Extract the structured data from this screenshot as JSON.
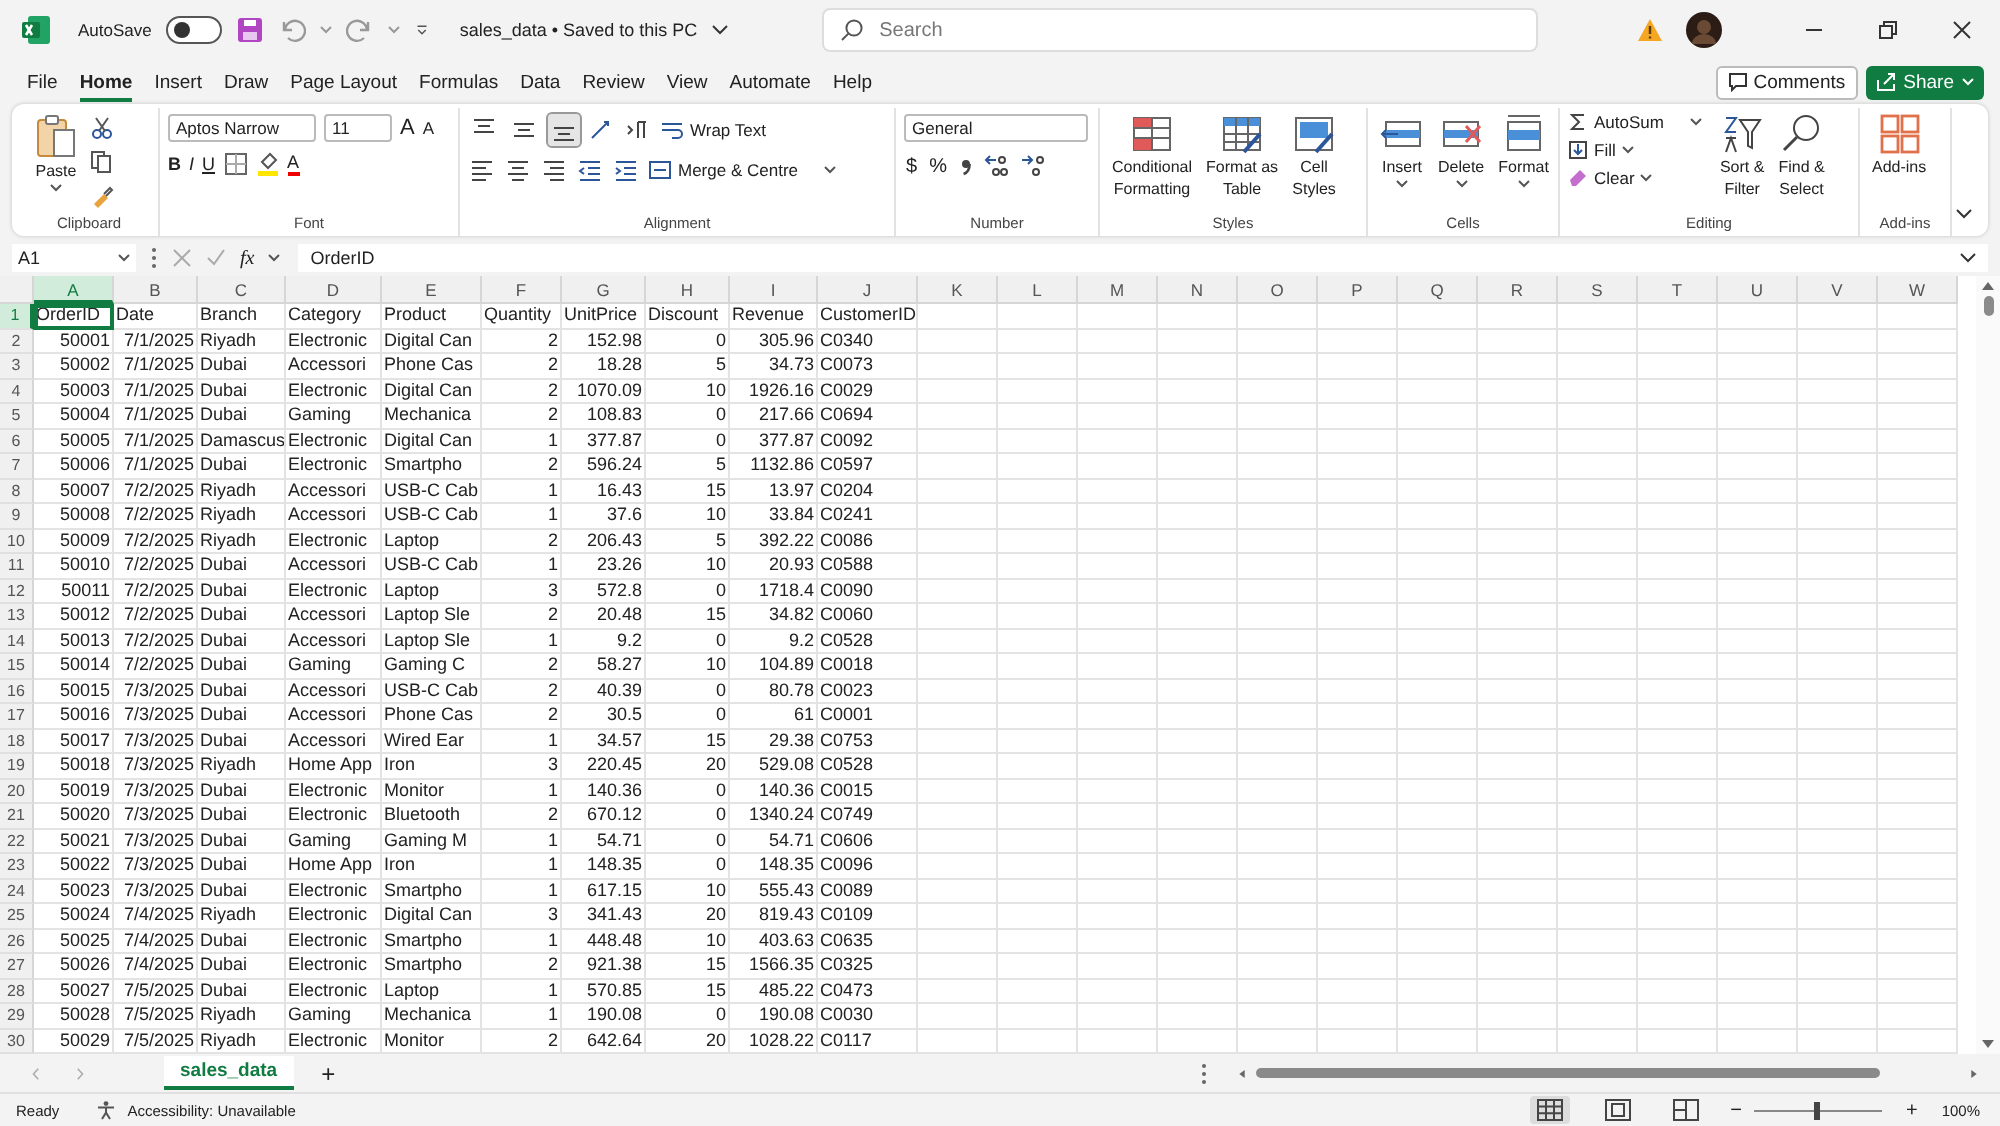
{
  "title_bar": {
    "autosave_label": "AutoSave",
    "autosave_on": false,
    "document_title": "sales_data • Saved to this PC",
    "search_placeholder": "Search"
  },
  "menu_tabs": [
    {
      "label": "File",
      "selected": false
    },
    {
      "label": "Home",
      "selected": true
    },
    {
      "label": "Insert",
      "selected": false
    },
    {
      "label": "Draw",
      "selected": false
    },
    {
      "label": "Page Layout",
      "selected": false
    },
    {
      "label": "Formulas",
      "selected": false
    },
    {
      "label": "Data",
      "selected": false
    },
    {
      "label": "Review",
      "selected": false
    },
    {
      "label": "View",
      "selected": false
    },
    {
      "label": "Automate",
      "selected": false
    },
    {
      "label": "Help",
      "selected": false
    }
  ],
  "top_buttons": {
    "comments": "Comments",
    "share": "Share"
  },
  "ribbon": {
    "clipboard": {
      "label": "Clipboard",
      "paste": "Paste"
    },
    "font": {
      "label": "Font",
      "family": "Aptos Narrow",
      "size": "11",
      "grow": "A",
      "shrink": "A",
      "styles": [
        "B",
        "I",
        "U"
      ],
      "font_color": "A"
    },
    "alignment": {
      "label": "Alignment",
      "vertical": [
        {
          "kind": "top",
          "selected": false
        },
        {
          "kind": "middle",
          "selected": false
        },
        {
          "kind": "bottom",
          "selected": true
        }
      ],
      "wrap": "Wrap Text",
      "merge": "Merge & Centre"
    },
    "number": {
      "label": "Number",
      "format": "General",
      "currency": "$",
      "percent": "%"
    },
    "styles": {
      "label": "Styles",
      "buttons": [
        {
          "kind": "conditional",
          "lines": [
            "Conditional",
            "Formatting"
          ]
        },
        {
          "kind": "table",
          "lines": [
            "Format as",
            "Table"
          ]
        },
        {
          "kind": "cellstyles",
          "lines": [
            "Cell",
            "Styles"
          ]
        }
      ]
    },
    "cells": {
      "label": "Cells",
      "buttons": [
        {
          "kind": "insert",
          "label": "Insert"
        },
        {
          "kind": "delete",
          "label": "Delete"
        },
        {
          "kind": "format",
          "label": "Format"
        }
      ]
    },
    "editing": {
      "label": "Editing",
      "autosum": "AutoSum",
      "fill": "Fill",
      "clear": "Clear",
      "buttons": [
        {
          "kind": "sort",
          "lines": [
            "Sort &",
            "Filter"
          ]
        },
        {
          "kind": "find",
          "lines": [
            "Find &",
            "Select"
          ]
        }
      ]
    },
    "addins": {
      "label": "Add-ins",
      "button": "Add-ins"
    }
  },
  "formula_bar": {
    "name_box": "A1",
    "fx": "fx",
    "content": "OrderID"
  },
  "sheet": {
    "columns": [
      {
        "letter": "A",
        "selected": true,
        "numeric": true
      },
      {
        "letter": "B",
        "selected": false,
        "numeric": true
      },
      {
        "letter": "C",
        "selected": false
      },
      {
        "letter": "D",
        "selected": false
      },
      {
        "letter": "E",
        "selected": false
      },
      {
        "letter": "F",
        "selected": false,
        "numeric": true
      },
      {
        "letter": "G",
        "selected": false,
        "numeric": true
      },
      {
        "letter": "H",
        "selected": false,
        "numeric": true
      },
      {
        "letter": "I",
        "selected": false,
        "numeric": true
      },
      {
        "letter": "J",
        "selected": false
      },
      {
        "letter": "K",
        "selected": false
      },
      {
        "letter": "L",
        "selected": false
      },
      {
        "letter": "M",
        "selected": false
      },
      {
        "letter": "N",
        "selected": false
      },
      {
        "letter": "O",
        "selected": false
      },
      {
        "letter": "P",
        "selected": false
      },
      {
        "letter": "Q",
        "selected": false
      },
      {
        "letter": "R",
        "selected": false
      },
      {
        "letter": "S",
        "selected": false
      },
      {
        "letter": "T",
        "selected": false
      },
      {
        "letter": "U",
        "selected": false
      },
      {
        "letter": "V",
        "selected": false
      },
      {
        "letter": "W",
        "selected": false
      }
    ],
    "rows": [
      {
        "number": "1",
        "selected": true,
        "kind": "header",
        "cells": [
          "OrderID",
          "Date",
          "Branch",
          "Category",
          "Product",
          "Quantity",
          "UnitPrice",
          "Discount",
          "Revenue",
          "CustomerID"
        ]
      },
      {
        "number": "2",
        "selected": false,
        "kind": "data",
        "cells": [
          "50001",
          "7/1/2025",
          "Riyadh",
          "Electronic",
          "Digital Can",
          "2",
          "152.98",
          "0",
          "305.96",
          "C0340"
        ]
      },
      {
        "number": "3",
        "selected": false,
        "kind": "data",
        "cells": [
          "50002",
          "7/1/2025",
          "Dubai",
          "Accessori",
          "Phone Cas",
          "2",
          "18.28",
          "5",
          "34.73",
          "C0073"
        ]
      },
      {
        "number": "4",
        "selected": false,
        "kind": "data",
        "cells": [
          "50003",
          "7/1/2025",
          "Dubai",
          "Electronic",
          "Digital Can",
          "2",
          "1070.09",
          "10",
          "1926.16",
          "C0029"
        ]
      },
      {
        "number": "5",
        "selected": false,
        "kind": "data",
        "cells": [
          "50004",
          "7/1/2025",
          "Dubai",
          "Gaming",
          "Mechanica",
          "2",
          "108.83",
          "0",
          "217.66",
          "C0694"
        ]
      },
      {
        "number": "6",
        "selected": false,
        "kind": "data",
        "cells": [
          "50005",
          "7/1/2025",
          "Damascus",
          "Electronic",
          "Digital Can",
          "1",
          "377.87",
          "0",
          "377.87",
          "C0092"
        ]
      },
      {
        "number": "7",
        "selected": false,
        "kind": "data",
        "cells": [
          "50006",
          "7/1/2025",
          "Dubai",
          "Electronic",
          "Smartpho",
          "2",
          "596.24",
          "5",
          "1132.86",
          "C0597"
        ]
      },
      {
        "number": "8",
        "selected": false,
        "kind": "data",
        "cells": [
          "50007",
          "7/2/2025",
          "Riyadh",
          "Accessori",
          "USB-C Cab",
          "1",
          "16.43",
          "15",
          "13.97",
          "C0204"
        ]
      },
      {
        "number": "9",
        "selected": false,
        "kind": "data",
        "cells": [
          "50008",
          "7/2/2025",
          "Riyadh",
          "Accessori",
          "USB-C Cab",
          "1",
          "37.6",
          "10",
          "33.84",
          "C0241"
        ]
      },
      {
        "number": "10",
        "selected": false,
        "kind": "data",
        "cells": [
          "50009",
          "7/2/2025",
          "Riyadh",
          "Electronic",
          "Laptop",
          "2",
          "206.43",
          "5",
          "392.22",
          "C0086"
        ]
      },
      {
        "number": "11",
        "selected": false,
        "kind": "data",
        "cells": [
          "50010",
          "7/2/2025",
          "Dubai",
          "Accessori",
          "USB-C Cab",
          "1",
          "23.26",
          "10",
          "20.93",
          "C0588"
        ]
      },
      {
        "number": "12",
        "selected": false,
        "kind": "data",
        "cells": [
          "50011",
          "7/2/2025",
          "Dubai",
          "Electronic",
          "Laptop",
          "3",
          "572.8",
          "0",
          "1718.4",
          "C0090"
        ]
      },
      {
        "number": "13",
        "selected": false,
        "kind": "data",
        "cells": [
          "50012",
          "7/2/2025",
          "Dubai",
          "Accessori",
          "Laptop Sle",
          "2",
          "20.48",
          "15",
          "34.82",
          "C0060"
        ]
      },
      {
        "number": "14",
        "selected": false,
        "kind": "data",
        "cells": [
          "50013",
          "7/2/2025",
          "Dubai",
          "Accessori",
          "Laptop Sle",
          "1",
          "9.2",
          "0",
          "9.2",
          "C0528"
        ]
      },
      {
        "number": "15",
        "selected": false,
        "kind": "data",
        "cells": [
          "50014",
          "7/2/2025",
          "Dubai",
          "Gaming",
          "Gaming C",
          "2",
          "58.27",
          "10",
          "104.89",
          "C0018"
        ]
      },
      {
        "number": "16",
        "selected": false,
        "kind": "data",
        "cells": [
          "50015",
          "7/3/2025",
          "Dubai",
          "Accessori",
          "USB-C Cab",
          "2",
          "40.39",
          "0",
          "80.78",
          "C0023"
        ]
      },
      {
        "number": "17",
        "selected": false,
        "kind": "data",
        "cells": [
          "50016",
          "7/3/2025",
          "Dubai",
          "Accessori",
          "Phone Cas",
          "2",
          "30.5",
          "0",
          "61",
          "C0001"
        ]
      },
      {
        "number": "18",
        "selected": false,
        "kind": "data",
        "cells": [
          "50017",
          "7/3/2025",
          "Dubai",
          "Accessori",
          "Wired Ear",
          "1",
          "34.57",
          "15",
          "29.38",
          "C0753"
        ]
      },
      {
        "number": "19",
        "selected": false,
        "kind": "data",
        "cells": [
          "50018",
          "7/3/2025",
          "Riyadh",
          "Home App",
          "Iron",
          "3",
          "220.45",
          "20",
          "529.08",
          "C0528"
        ]
      },
      {
        "number": "20",
        "selected": false,
        "kind": "data",
        "cells": [
          "50019",
          "7/3/2025",
          "Dubai",
          "Electronic",
          "Monitor",
          "1",
          "140.36",
          "0",
          "140.36",
          "C0015"
        ]
      },
      {
        "number": "21",
        "selected": false,
        "kind": "data",
        "cells": [
          "50020",
          "7/3/2025",
          "Dubai",
          "Electronic",
          "Bluetooth",
          "2",
          "670.12",
          "0",
          "1340.24",
          "C0749"
        ]
      },
      {
        "number": "22",
        "selected": false,
        "kind": "data",
        "cells": [
          "50021",
          "7/3/2025",
          "Dubai",
          "Gaming",
          "Gaming M",
          "1",
          "54.71",
          "0",
          "54.71",
          "C0606"
        ]
      },
      {
        "number": "23",
        "selected": false,
        "kind": "data",
        "cells": [
          "50022",
          "7/3/2025",
          "Dubai",
          "Home App",
          "Iron",
          "1",
          "148.35",
          "0",
          "148.35",
          "C0096"
        ]
      },
      {
        "number": "24",
        "selected": false,
        "kind": "data",
        "cells": [
          "50023",
          "7/3/2025",
          "Dubai",
          "Electronic",
          "Smartpho",
          "1",
          "617.15",
          "10",
          "555.43",
          "C0089"
        ]
      },
      {
        "number": "25",
        "selected": false,
        "kind": "data",
        "cells": [
          "50024",
          "7/4/2025",
          "Riyadh",
          "Electronic",
          "Digital Can",
          "3",
          "341.43",
          "20",
          "819.43",
          "C0109"
        ]
      },
      {
        "number": "26",
        "selected": false,
        "kind": "data",
        "cells": [
          "50025",
          "7/4/2025",
          "Dubai",
          "Electronic",
          "Smartpho",
          "1",
          "448.48",
          "10",
          "403.63",
          "C0635"
        ]
      },
      {
        "number": "27",
        "selected": false,
        "kind": "data",
        "cells": [
          "50026",
          "7/4/2025",
          "Dubai",
          "Electronic",
          "Smartpho",
          "2",
          "921.38",
          "15",
          "1566.35",
          "C0325"
        ]
      },
      {
        "number": "28",
        "selected": false,
        "kind": "data",
        "cells": [
          "50027",
          "7/5/2025",
          "Dubai",
          "Electronic",
          "Laptop",
          "1",
          "570.85",
          "15",
          "485.22",
          "C0473"
        ]
      },
      {
        "number": "29",
        "selected": false,
        "kind": "data",
        "cells": [
          "50028",
          "7/5/2025",
          "Riyadh",
          "Gaming",
          "Mechanica",
          "1",
          "190.08",
          "0",
          "190.08",
          "C0030"
        ]
      },
      {
        "number": "30",
        "selected": false,
        "kind": "data",
        "cells": [
          "50029",
          "7/5/2025",
          "Riyadh",
          "Electronic",
          "Monitor",
          "2",
          "642.64",
          "20",
          "1028.22",
          "C0117"
        ]
      }
    ]
  },
  "sheet_tabs": {
    "tabs": [
      {
        "label": "sales_data",
        "selected": true
      }
    ],
    "add": "+"
  },
  "status_bar": {
    "ready": "Ready",
    "accessibility": "Accessibility: Unavailable",
    "views": [
      {
        "kind": "normal",
        "selected": true
      },
      {
        "kind": "layout",
        "selected": false
      },
      {
        "kind": "pagebreak",
        "selected": false
      }
    ],
    "minus": "−",
    "plus": "+",
    "zoom": {
      "level": 0.5,
      "reading": "100%"
    }
  }
}
